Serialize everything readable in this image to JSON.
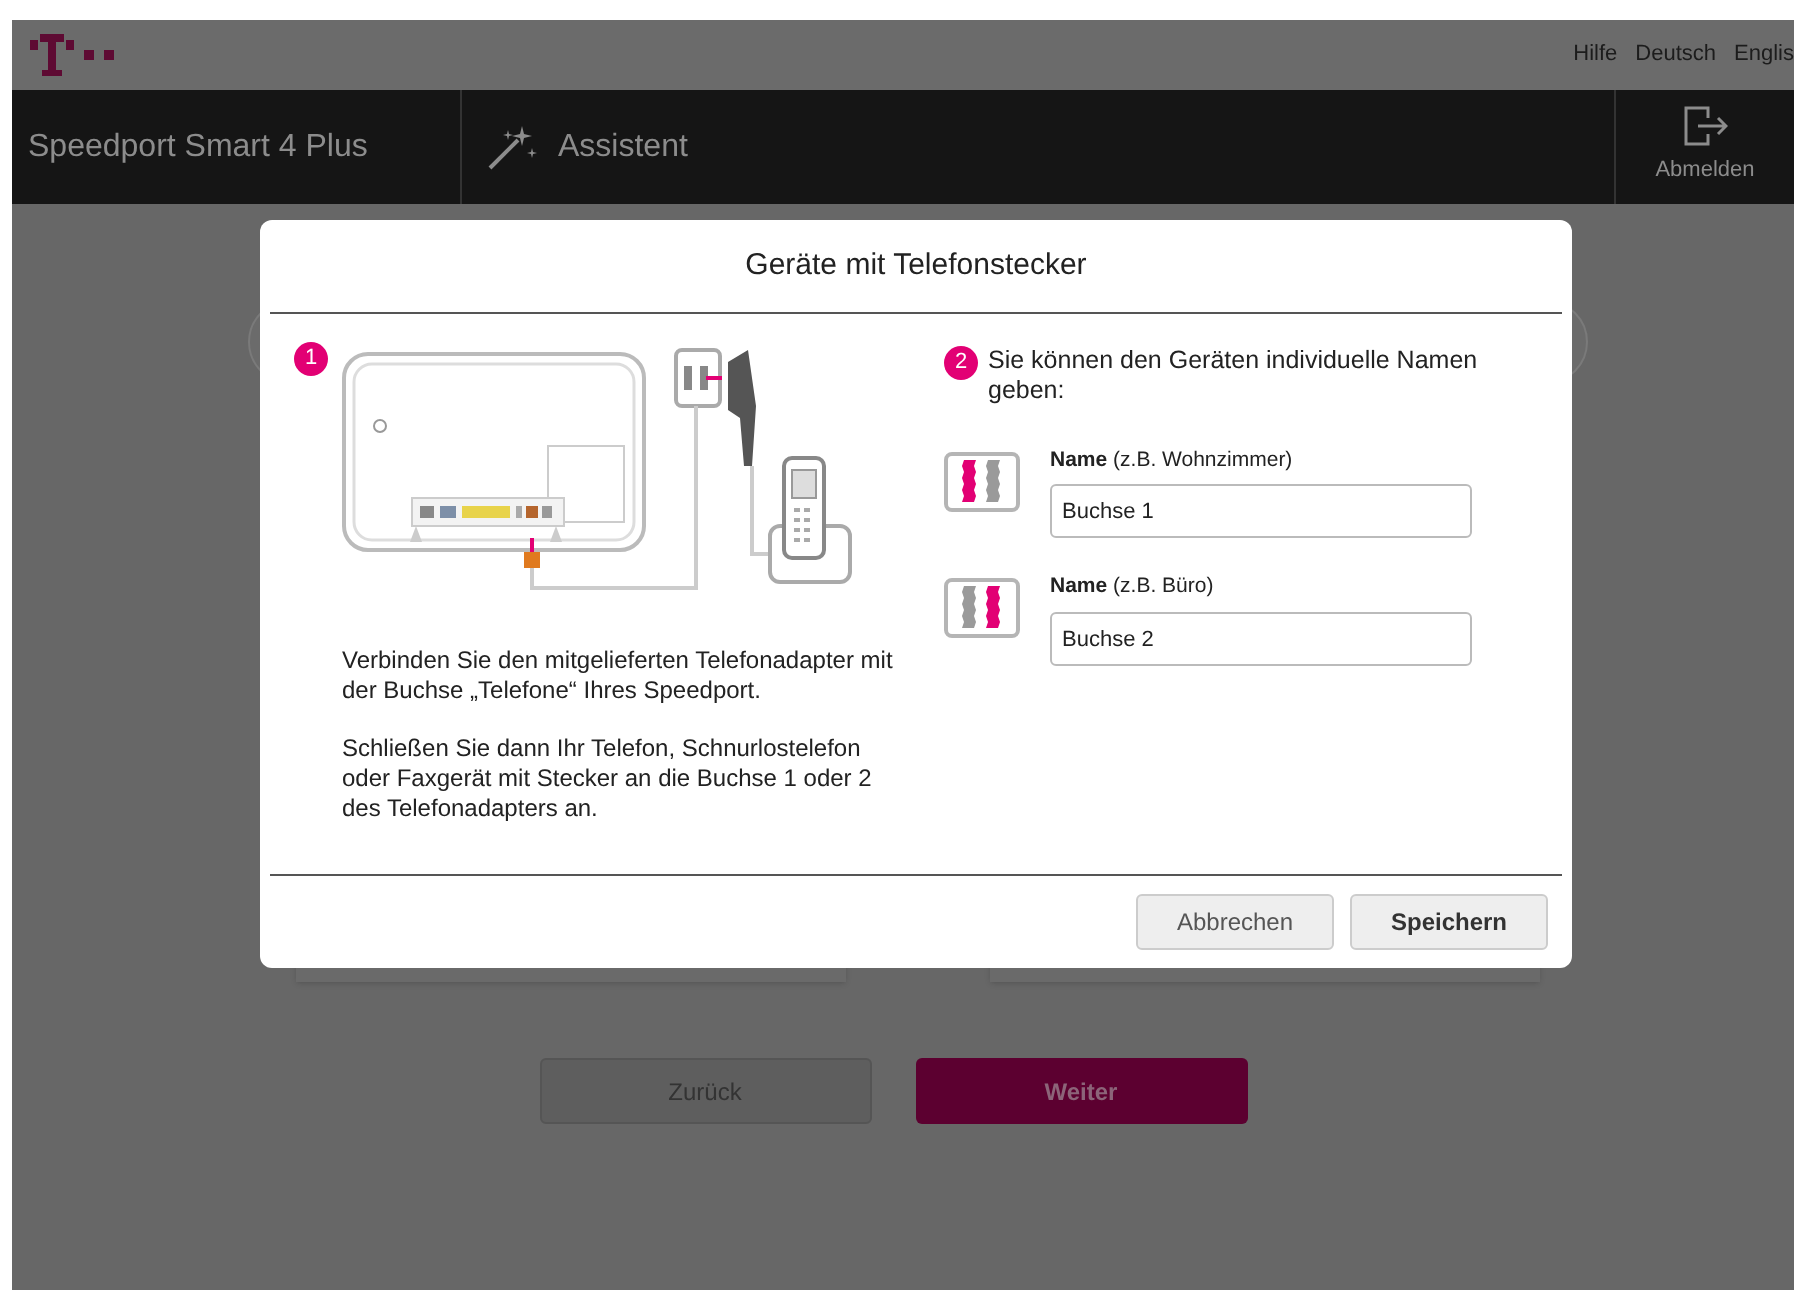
{
  "topbar": {
    "links": [
      "Hilfe",
      "Deutsch",
      "Englis"
    ]
  },
  "navbar": {
    "product": "Speedport Smart 4 Plus",
    "section": "Assistent",
    "logout": "Abmelden"
  },
  "dialog": {
    "title": "Geräte mit Telefonstecker",
    "step1": {
      "number": "1",
      "paragraphs": [
        "Verbinden Sie den mitgelieferten Telefonadapter mit der Buchse „Telefone“ Ihres Speedport.",
        "Schließen Sie dann Ihr Telefon, Schnurlostelefon oder Faxgerät mit Stecker an die Buchse 1 oder 2 des Telefonadapters an."
      ]
    },
    "step2": {
      "number": "2",
      "text": "Sie können den Geräten individuelle Namen geben:",
      "fields": [
        {
          "label": "Name",
          "hint": "(z.B. Wohnzimmer)",
          "value": "Buchse 1",
          "sockets": [
            {
              "highlighted": true
            },
            {
              "highlighted": false
            }
          ]
        },
        {
          "label": "Name",
          "hint": "(z.B. Büro)",
          "value": "Buchse 2",
          "sockets": [
            {
              "highlighted": false
            },
            {
              "highlighted": true
            }
          ]
        }
      ]
    },
    "buttons": [
      {
        "label": "Abbrechen",
        "primary": false
      },
      {
        "label": "Speichern",
        "primary": true
      }
    ]
  },
  "footer_buttons": [
    {
      "label": "Zurück",
      "primary": false
    },
    {
      "label": "Weiter",
      "primary": true
    }
  ]
}
